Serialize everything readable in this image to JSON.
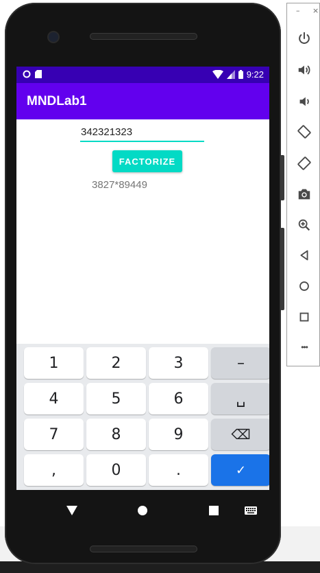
{
  "emulator_panel": {
    "window_minimize": "–",
    "window_close": "×",
    "buttons": [
      {
        "icon": "power-icon"
      },
      {
        "icon": "volume-up-icon"
      },
      {
        "icon": "volume-down-icon"
      },
      {
        "icon": "rotate-left-icon"
      },
      {
        "icon": "rotate-right-icon"
      },
      {
        "icon": "camera-icon"
      },
      {
        "icon": "zoom-icon"
      },
      {
        "icon": "back-icon"
      },
      {
        "icon": "home-icon"
      },
      {
        "icon": "overview-icon"
      },
      {
        "icon": "more-icon"
      }
    ],
    "more_label": "•••"
  },
  "status_bar": {
    "time": "9:22"
  },
  "app": {
    "title": "MNDLab1",
    "input_value": "342321323",
    "button_label": "FACTORIZE",
    "result": "3827*89449"
  },
  "keyboard": {
    "rows": [
      [
        "1",
        "2",
        "3",
        "–"
      ],
      [
        "4",
        "5",
        "6",
        "␣"
      ],
      [
        "7",
        "8",
        "9",
        "⌫"
      ],
      [
        ",",
        "0",
        ".",
        "✓"
      ]
    ]
  },
  "colors": {
    "status_bar": "#3700b3",
    "app_bar": "#6200ee",
    "accent": "#03dac5",
    "keyboard_done": "#1a73e8"
  }
}
